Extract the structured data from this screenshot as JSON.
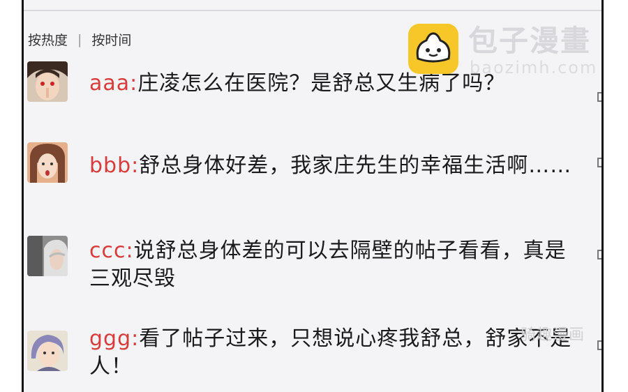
{
  "sort": {
    "by_heat": "按热度",
    "separator": "|",
    "by_time": "按时间"
  },
  "comments": [
    {
      "user": "aaa",
      "colon": ":",
      "text": "庄凌怎么在医院？是舒总又生病了吗？"
    },
    {
      "user": "bbb",
      "colon": ":",
      "text": "舒总身体好差，我家庄先生的幸福生活啊……"
    },
    {
      "user": "ccc",
      "colon": ":",
      "text": "说舒总身体差的可以去隔壁的帖子看看，真是三观尽毁"
    },
    {
      "user": "ggg",
      "colon": ":",
      "text": "看了帖子过来，只想说心疼我舒总，舒家不是人！"
    }
  ],
  "watermark": {
    "title": "包子漫畫",
    "url": "baozimh.com",
    "secondary": "骑趣漫画"
  },
  "colors": {
    "username": "#d93b3b",
    "logo": "#f7c629",
    "background": "#f4f4f6"
  }
}
